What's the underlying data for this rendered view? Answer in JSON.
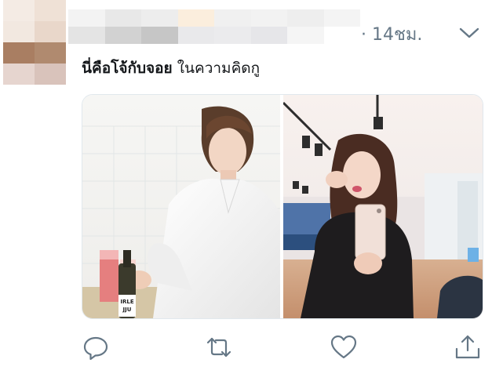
{
  "tweet": {
    "time_prefix": "· ",
    "time": "14ชม.",
    "text_bold": "นี่คือโจ้กับจอย",
    "text_rest": " ในความคิดกู"
  },
  "icons": {
    "menu": "chevron-down-icon",
    "reply": "reply-icon",
    "retweet": "retweet-icon",
    "like": "heart-icon",
    "share": "share-icon"
  },
  "colors": {
    "text": "#14171a",
    "muted": "#657786"
  },
  "media": {
    "left_bottle_label": "IRLE\nJJU"
  }
}
